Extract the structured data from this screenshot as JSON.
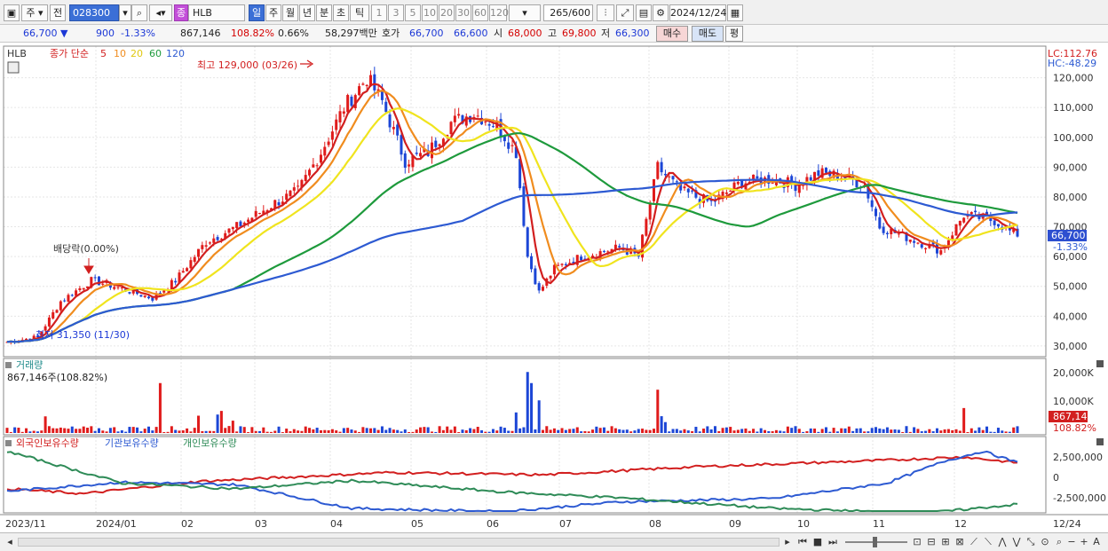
{
  "toolbar": {
    "period_unit": "주",
    "prev_label": "전",
    "stock_code": "028300",
    "stock_type_badge": "종",
    "stock_name": "HLB",
    "tabs": [
      "일",
      "주",
      "월",
      "년",
      "분",
      "초",
      "틱"
    ],
    "active_tab": "일",
    "intervals": [
      "1",
      "3",
      "5",
      "10",
      "20",
      "30",
      "60",
      "120"
    ],
    "count": "265",
    "count_total": "/600",
    "date": "2024/12/24",
    "icons": [
      "window-icon",
      "search-icon",
      "volume-icon",
      "settings-icon",
      "calendar-icon",
      "save-icon"
    ]
  },
  "quote": {
    "price": "66,700",
    "change": "900",
    "change_pct": "-1.33%",
    "volume": "867,146",
    "volume_ratio": "108.82%",
    "turnover": "0.66%",
    "trade_value": "58,297백만",
    "bid_label": "호가",
    "ask_price": "66,700",
    "bid_price": "66,600",
    "open_label": "시",
    "open": "68,000",
    "high_label": "고",
    "high": "69,800",
    "low_label": "저",
    "low": "66,300",
    "buy_button": "매수",
    "sell_button": "매도",
    "avg_button": "평"
  },
  "price_panel": {
    "symbol": "HLB",
    "legend_title": "종가 단순",
    "ma_periods": [
      "5",
      "10",
      "20",
      "60",
      "120"
    ],
    "ma_colors": [
      "#d21f1f",
      "#f08c1e",
      "#f0e41e",
      "#1e9a3c",
      "#2d5ad2"
    ],
    "lc": "LC:112.76",
    "hc": "HC:-48.29",
    "high_annotation": "최고 129,000 (03/26)",
    "low_annotation": "최저 31,350 (11/30)",
    "dividend_annotation": "배당락(0.00%)",
    "current_price": "66,700",
    "current_change": "-1.33%",
    "y_ticks": [
      "120,000",
      "110,000",
      "100,000",
      "90,000",
      "80,000",
      "70,000",
      "60,000",
      "50,000",
      "40,000",
      "30,000"
    ]
  },
  "volume_panel": {
    "title": "거래량",
    "summary": "867,146주(108.82%)",
    "y_ticks": [
      "20,000K",
      "10,000K"
    ],
    "last_volume": "867,146",
    "last_ratio": "108.82%"
  },
  "holdings_panel": {
    "series_labels": [
      "외국인보유수량",
      "기관보유수량",
      "개인보유수량"
    ],
    "series_colors": [
      "#d21f1f",
      "#2d5ad2",
      "#2e8b57"
    ],
    "y_ticks": [
      "2,500,000",
      "0",
      "-2,500,000"
    ]
  },
  "x_axis": [
    "2023/11",
    "2024/01",
    "02",
    "03",
    "04",
    "05",
    "06",
    "07",
    "08",
    "09",
    "10",
    "11",
    "12",
    "12/24"
  ],
  "chart_data": {
    "type": "candlestick",
    "y_range_price": [
      27000,
      130000
    ],
    "close_anchors": [
      [
        0,
        31350
      ],
      [
        8,
        33000
      ],
      [
        14,
        45000
      ],
      [
        22,
        52000
      ],
      [
        28,
        50000
      ],
      [
        38,
        46000
      ],
      [
        44,
        52000
      ],
      [
        52,
        65000
      ],
      [
        60,
        70000
      ],
      [
        70,
        78000
      ],
      [
        76,
        82000
      ],
      [
        82,
        95000
      ],
      [
        88,
        110000
      ],
      [
        94,
        120000
      ],
      [
        98,
        112000
      ],
      [
        104,
        92000
      ],
      [
        110,
        95000
      ],
      [
        116,
        105000
      ],
      [
        122,
        108000
      ],
      [
        128,
        104000
      ],
      [
        133,
        95000
      ],
      [
        136,
        60000
      ],
      [
        139,
        48000
      ],
      [
        143,
        56000
      ],
      [
        150,
        60000
      ],
      [
        160,
        63000
      ],
      [
        165,
        60000
      ],
      [
        170,
        90000
      ],
      [
        176,
        82000
      ],
      [
        184,
        78000
      ],
      [
        192,
        85000
      ],
      [
        200,
        86000
      ],
      [
        206,
        84000
      ],
      [
        212,
        88000
      ],
      [
        218,
        87000
      ],
      [
        224,
        84000
      ],
      [
        228,
        70000
      ],
      [
        236,
        66000
      ],
      [
        244,
        62000
      ],
      [
        250,
        74000
      ],
      [
        258,
        72000
      ],
      [
        264,
        66700
      ]
    ],
    "ma_periods": [
      5,
      10,
      20,
      60,
      120
    ],
    "volume_peaks": [
      [
        10,
        6
      ],
      [
        40,
        18
      ],
      [
        136,
        22
      ],
      [
        137,
        18
      ],
      [
        170,
        10
      ],
      [
        250,
        9
      ]
    ],
    "holdings_ticks": [
      2500000,
      0,
      -2500000
    ]
  }
}
